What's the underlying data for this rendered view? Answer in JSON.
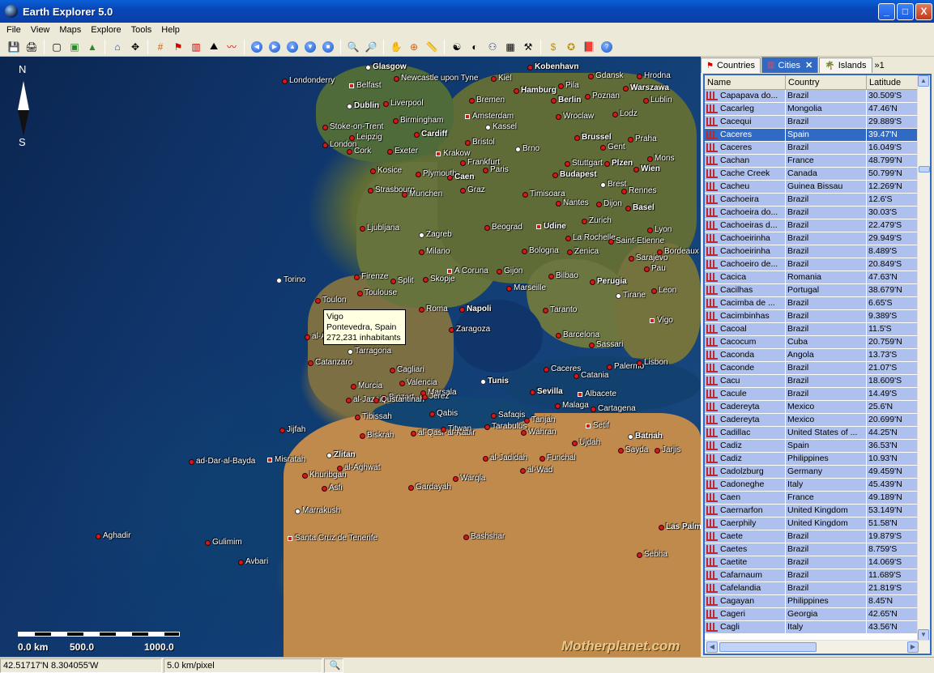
{
  "window": {
    "title": "Earth Explorer 5.0",
    "controls": [
      "_",
      "□",
      "X"
    ]
  },
  "menu": [
    "File",
    "View",
    "Maps",
    "Explore",
    "Tools",
    "Help"
  ],
  "map": {
    "compass": {
      "north": "N",
      "south": "S"
    },
    "scale": {
      "labels": [
        "0.0 km",
        "500.0",
        "1000.0"
      ]
    },
    "watermark": "Motherplanet.com",
    "tooltip": {
      "line1": "Vigo",
      "line2": "Pontevedra, Spain",
      "line3": "272,231 inhabitants"
    },
    "places": [
      "Glasgow",
      "Kobenhavn",
      "Gdansk",
      "Hrodna",
      "Londonderry",
      "Belfast",
      "Newcastle upon Tyne",
      "Kiel",
      "Hamburg",
      "Pila",
      "Warszawa",
      "Dublin",
      "Liverpool",
      "Bremen",
      "Berlin",
      "Poznan",
      "Lublin",
      "Birmingham",
      "Amsterdam",
      "Wroclaw",
      "Lodz",
      "Stoke-on-Trent",
      "Kassel",
      "Leipzig",
      "Cardiff",
      "London",
      "Cork",
      "Exeter",
      "Bristol",
      "Brussel",
      "Praha",
      "Krakow",
      "Gent",
      "Brno",
      "Frankfurt",
      "Mons",
      "Kosice",
      "Plymouth",
      "Caen",
      "Paris",
      "Stuttgart",
      "Plzen",
      "Wien",
      "Budapest",
      "Brest",
      "Rennes",
      "Strasbourg",
      "Munchen",
      "Graz",
      "Timisoara",
      "Nantes",
      "Dijon",
      "Basel",
      "Zurich",
      "Ljubljana",
      "Zagreb",
      "Beograd",
      "Udine",
      "La Rochelle",
      "Saint-Etienne",
      "Lyon",
      "Milano",
      "Bologna",
      "Zenica",
      "Sarajevo",
      "Bordeaux",
      "Torino",
      "Firenze",
      "Split",
      "Skopje",
      "A Coruna",
      "Gijon",
      "Bilbao",
      "Pau",
      "Toulouse",
      "Marseille",
      "Perugia",
      "Tirane",
      "Leon",
      "Toulon",
      "Roma",
      "Napoli",
      "Taranto",
      "Vigo",
      "Zaragoza",
      "Barcelona",
      "Sassari",
      "Catanzaro",
      "Tarragona",
      "Cagliari",
      "Palermo",
      "Lisbon",
      "Caceres",
      "Valencia",
      "Marsala",
      "Catania",
      "Albacete",
      "Murcia",
      "Binzart",
      "Tunis",
      "Sevilla",
      "al-Jazair",
      "Qustantinah",
      "Jerez",
      "Malaga",
      "Cartagena",
      "Tibissah",
      "Safaqis",
      "Tanjah",
      "Setif",
      "Batnah",
      "Qabis",
      "Tarabulus",
      "Wahran",
      "Jijfah",
      "Biskrah",
      "al-Qasr-al-Kabir",
      "Titwan",
      "Ujdah",
      "Sayda",
      "Jarjis",
      "Zlitan",
      "Misratah",
      "ad-Dar-al-Bayda",
      "al-Jadidah",
      "Funchal",
      "al-Aghwat",
      "al-Wad",
      "Khuribgah",
      "Warqla",
      "Asfi",
      "Gardayah",
      "Marrakush",
      "Bashshar",
      "Aghadir",
      "Santa Cruz de Tenerife",
      "Gulimim",
      "Las Palmas",
      "Sebha",
      "Avbari",
      "al-Ayun",
      "Se"
    ]
  },
  "panel": {
    "tabs": [
      {
        "label": "Countries"
      },
      {
        "label": "Cities"
      },
      {
        "label": "Islands"
      },
      {
        "label": "1"
      }
    ],
    "columns": [
      "Name",
      "Country",
      "Latitude"
    ],
    "rows": [
      [
        "Capapava do...",
        "Brazil",
        "30.509'S"
      ],
      [
        "Cacarleg",
        "Mongolia",
        "47.46'N"
      ],
      [
        "Cacequi",
        "Brazil",
        "29.889'S"
      ],
      [
        "Caceres",
        "Spain",
        "39.47'N"
      ],
      [
        "Caceres",
        "Brazil",
        "16.049'S"
      ],
      [
        "Cachan",
        "France",
        "48.799'N"
      ],
      [
        "Cache Creek",
        "Canada",
        "50.799'N"
      ],
      [
        "Cacheu",
        "Guinea Bissau",
        "12.269'N"
      ],
      [
        "Cachoeira",
        "Brazil",
        "12.6'S"
      ],
      [
        "Cachoeira do...",
        "Brazil",
        "30.03'S"
      ],
      [
        "Cachoeiras d...",
        "Brazil",
        "22.479'S"
      ],
      [
        "Cachoeirinha",
        "Brazil",
        "29.949'S"
      ],
      [
        "Cachoeirinha",
        "Brazil",
        "8.489'S"
      ],
      [
        "Cachoeiro de...",
        "Brazil",
        "20.849'S"
      ],
      [
        "Cacica",
        "Romania",
        "47.63'N"
      ],
      [
        "Cacilhas",
        "Portugal",
        "38.679'N"
      ],
      [
        "Cacimba de ...",
        "Brazil",
        "6.65'S"
      ],
      [
        "Cacimbinhas",
        "Brazil",
        "9.389'S"
      ],
      [
        "Cacoal",
        "Brazil",
        "11.5'S"
      ],
      [
        "Cacocum",
        "Cuba",
        "20.759'N"
      ],
      [
        "Caconda",
        "Angola",
        "13.73'S"
      ],
      [
        "Caconde",
        "Brazil",
        "21.07'S"
      ],
      [
        "Cacu",
        "Brazil",
        "18.609'S"
      ],
      [
        "Cacule",
        "Brazil",
        "14.49'S"
      ],
      [
        "Cadereyta",
        "Mexico",
        "25.6'N"
      ],
      [
        "Cadereyta",
        "Mexico",
        "20.699'N"
      ],
      [
        "Cadillac",
        "United States of ...",
        "44.25'N"
      ],
      [
        "Cadiz",
        "Spain",
        "36.53'N"
      ],
      [
        "Cadiz",
        "Philippines",
        "10.93'N"
      ],
      [
        "Cadolzburg",
        "Germany",
        "49.459'N"
      ],
      [
        "Cadoneghe",
        "Italy",
        "45.439'N"
      ],
      [
        "Caen",
        "France",
        "49.189'N"
      ],
      [
        "Caernarfon",
        "United Kingdom",
        "53.149'N"
      ],
      [
        "Caerphily",
        "United Kingdom",
        "51.58'N"
      ],
      [
        "Caete",
        "Brazil",
        "19.879'S"
      ],
      [
        "Caetes",
        "Brazil",
        "8.759'S"
      ],
      [
        "Caetite",
        "Brazil",
        "14.069'S"
      ],
      [
        "Cafarnaum",
        "Brazil",
        "11.689'S"
      ],
      [
        "Cafelandia",
        "Brazil",
        "21.819'S"
      ],
      [
        "Cagayan",
        "Philippines",
        "8.45'N"
      ],
      [
        "Cageri",
        "Georgia",
        "42.65'N"
      ],
      [
        "Cagli",
        "Italy",
        "43.56'N"
      ]
    ],
    "selected_row": 3
  },
  "status": {
    "coords": "42.51717'N  8.304055'W",
    "resolution": "5.0 km/pixel"
  }
}
